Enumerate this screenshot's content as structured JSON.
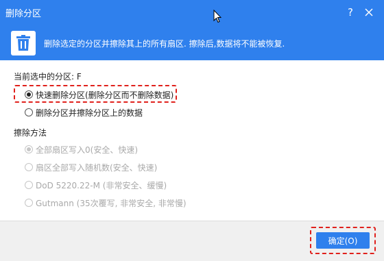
{
  "window": {
    "title": "删除分区",
    "help_label": "?"
  },
  "banner": {
    "icon": "trash-icon",
    "text": "删除选定的分区并擦除其上的所有扇区. 擦除后,数据将不能被恢复."
  },
  "current_partition_label": "当前选中的分区: F",
  "delete_options": [
    {
      "label": "快速删除分区(删除分区而不删除数据)",
      "checked": true
    },
    {
      "label": "删除分区并擦除分区上的数据",
      "checked": false
    }
  ],
  "wipe_method": {
    "heading": "擦除方法",
    "options": [
      {
        "label": "全部扇区写入0(安全、快速)",
        "checked": true,
        "enabled": false
      },
      {
        "label": "扇区全部写入随机数(安全、快速)",
        "checked": false,
        "enabled": false
      },
      {
        "label": "DoD 5220.22-M (非常安全、缓慢)",
        "checked": false,
        "enabled": false
      },
      {
        "label": "Gutmann (35次覆写, 非常安全, 非常慢)",
        "checked": false,
        "enabled": false
      }
    ]
  },
  "footer": {
    "ok_label": "确定(O)"
  },
  "colors": {
    "accent": "#2f80ed",
    "highlight": "#e0201b",
    "footer_bg": "#f0f0f0"
  }
}
